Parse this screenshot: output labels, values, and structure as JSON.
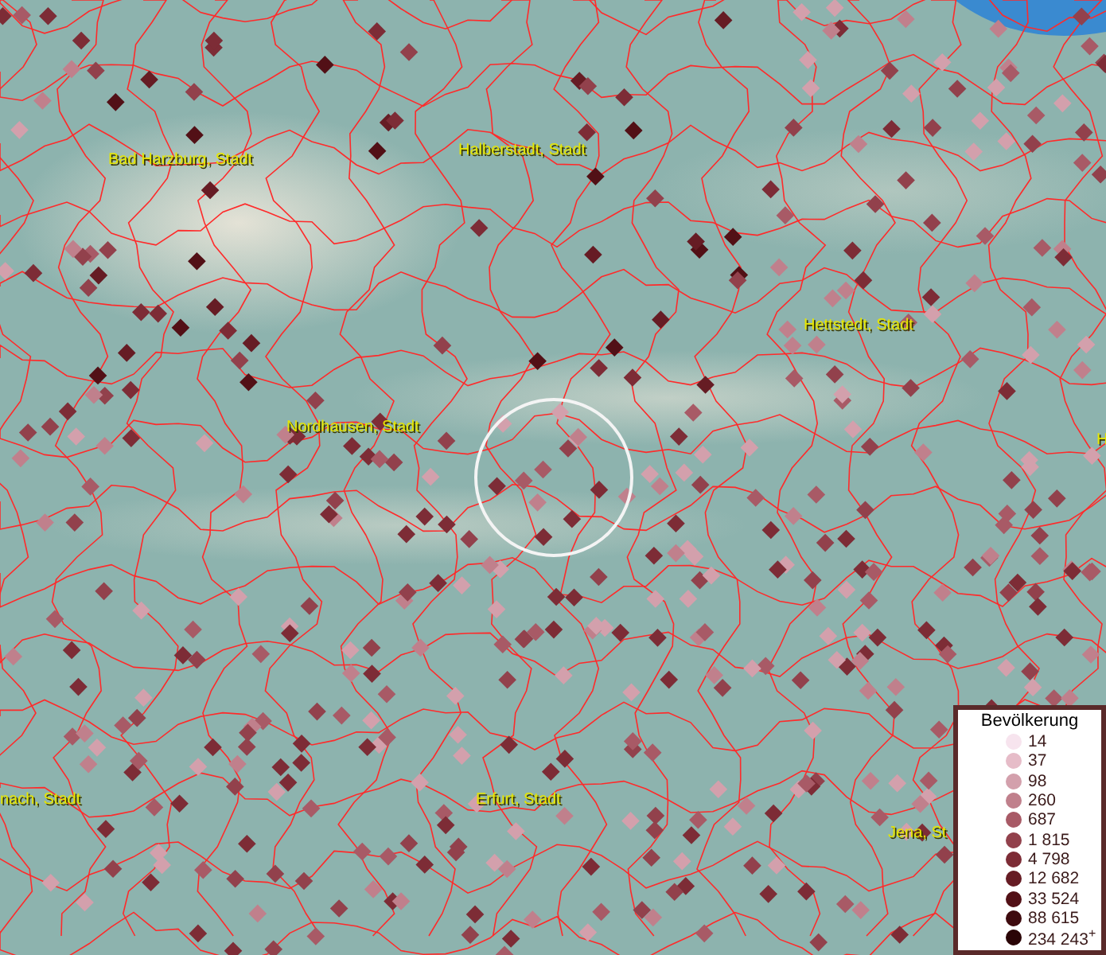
{
  "map": {
    "place_labels": [
      "Bad Harzburg, Stadt",
      "Halberstadt, Stadt",
      "Hettstedt, Stadt",
      "H",
      "Nordhausen, Stadt",
      "nach, Stadt",
      "Erfurt, Stadt",
      "Jena, St"
    ]
  },
  "legend": {
    "title": "Bevölkerung",
    "items": [
      {
        "label": "14",
        "color": "#f7e4ee"
      },
      {
        "label": "37",
        "color": "#e6bcc8"
      },
      {
        "label": "98",
        "color": "#d3a0ac"
      },
      {
        "label": "260",
        "color": "#c0808c"
      },
      {
        "label": "687",
        "color": "#a85a66"
      },
      {
        "label": "1 815",
        "color": "#92414c"
      },
      {
        "label": "4 798",
        "color": "#7d2c36"
      },
      {
        "label": "12 682",
        "color": "#661c24"
      },
      {
        "label": "33 524",
        "color": "#521016"
      },
      {
        "label": "88 615",
        "color": "#3e0a0e"
      },
      {
        "label": "234 243$^{+}$",
        "color": "#2a0406"
      }
    ]
  }
}
